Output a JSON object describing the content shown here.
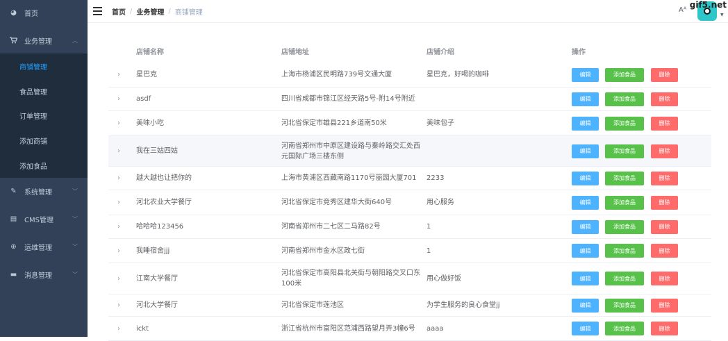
{
  "sidebar": {
    "items": [
      {
        "label": "首页",
        "icon": "dashboard-icon",
        "glyph": "◕"
      },
      {
        "label": "业务管理",
        "icon": "cart-icon",
        "glyph": "🛒",
        "arrow": "︿"
      },
      {
        "label": "系统管理",
        "icon": "edit-icon",
        "glyph": "✎",
        "arrow": "﹀"
      },
      {
        "label": "CMS管理",
        "icon": "document-icon",
        "glyph": "▤",
        "arrow": "﹀"
      },
      {
        "label": "运维管理",
        "icon": "plus-circle-icon",
        "glyph": "⊕",
        "arrow": "﹀"
      },
      {
        "label": "消息管理",
        "icon": "message-icon",
        "glyph": "▬",
        "arrow": "﹀"
      }
    ],
    "submenu": [
      {
        "label": "商铺管理"
      },
      {
        "label": "食品管理"
      },
      {
        "label": "订单管理"
      },
      {
        "label": "添加商铺"
      },
      {
        "label": "添加食品"
      }
    ]
  },
  "header": {
    "breadcrumb": [
      "首页",
      "业务管理",
      "商铺管理"
    ],
    "separator": "/",
    "font_size_glyph": "Aᴬ",
    "watermark": "gif5.net"
  },
  "table": {
    "columns": [
      "店铺名称",
      "店铺地址",
      "店铺介绍",
      "操作"
    ],
    "buttons": {
      "edit": "编辑",
      "add_food": "添加食品",
      "delete": "删除"
    },
    "expand_glyph": "›",
    "rows": [
      {
        "name": "星巴克",
        "address": "上海市杨浦区民明路739号文通大厦",
        "desc": "星巴克，好喝的咖啡"
      },
      {
        "name": "asdf",
        "address": "四川省成都市锦江区经天路5号-附14号附近",
        "desc": ""
      },
      {
        "name": "美味小吃",
        "address": "河北省保定市雄县221乡道南50米",
        "desc": "美味包子"
      },
      {
        "name": "我在三姑四姑",
        "address": "河南省郑州市中原区建设路与秦岭路交汇处西元国际广场三楼东侧",
        "desc": ""
      },
      {
        "name": "越大越也让把你的",
        "address": "上海市黄浦区西藏南路1170号丽园大厦701",
        "desc": "2233"
      },
      {
        "name": "河北农业大学餐厅",
        "address": "河北省保定市竞秀区建华大街640号",
        "desc": "用心服务"
      },
      {
        "name": "哈哈哈123456",
        "address": "河南省郑州市二七区二马路82号",
        "desc": "1"
      },
      {
        "name": "我睡宿舍jjj",
        "address": "河南省郑州市金水区政七街",
        "desc": "1"
      },
      {
        "name": "江南大学餐厅",
        "address": "河北省保定市高阳县北关街与朝阳路交叉口东100米",
        "desc": "用心做好饭"
      },
      {
        "name": "河北大学餐厅",
        "address": "河北省保定市莲池区",
        "desc": "为学生服务的良心食堂jj"
      },
      {
        "name": "ickt",
        "address": "浙江省杭州市富阳区范浦西路望月弄3幢6号",
        "desc": "aaaa"
      }
    ]
  },
  "colors": {
    "sidebar_bg": "#324157",
    "submenu_bg": "#1f2d3d",
    "active": "#20a0ff",
    "edit": "#4db3ff",
    "add": "#58c14a",
    "delete": "#ff6b6b",
    "avatar": "#2ec7c9"
  }
}
